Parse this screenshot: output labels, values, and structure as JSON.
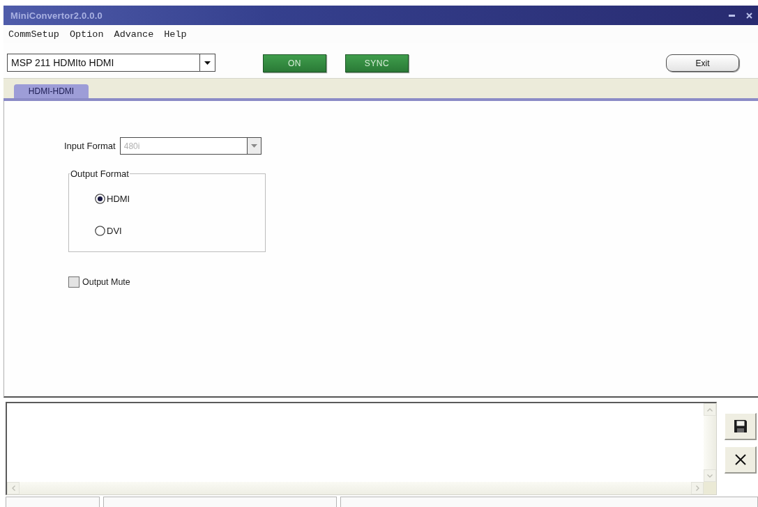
{
  "window": {
    "title": "MiniConvertor2.0.0.0"
  },
  "menu": [
    "CommSetup",
    "Option",
    "Advance",
    "Help"
  ],
  "device_select": {
    "value": "MSP 211 HDMIto HDMI"
  },
  "toolbar_buttons": [
    {
      "label": "ON",
      "kind": "indicator"
    },
    {
      "label": "SYNC",
      "kind": "indicator"
    },
    {
      "label": "Exit",
      "kind": "push"
    }
  ],
  "tabs": [
    {
      "label": "HDMI-HDMI",
      "selected": true
    }
  ],
  "input_format": {
    "label": "Input Format",
    "value": "480i",
    "disabled": true
  },
  "output_format": {
    "legend": "Output Format",
    "options": [
      {
        "label": "HDMI",
        "selected": true
      },
      {
        "label": "DVI",
        "selected": false
      }
    ]
  },
  "output_mute": {
    "label": "Output Mute",
    "checked": false
  }
}
